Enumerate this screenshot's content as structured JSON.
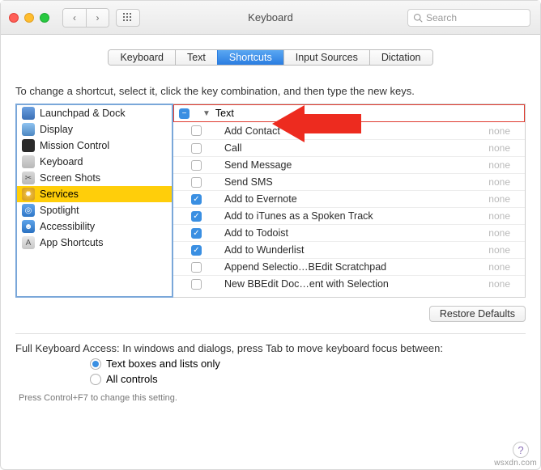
{
  "window": {
    "title": "Keyboard"
  },
  "toolbar": {
    "search_placeholder": "Search"
  },
  "tabs": {
    "keyboard": "Keyboard",
    "text": "Text",
    "shortcuts": "Shortcuts",
    "input_sources": "Input Sources",
    "dictation": "Dictation"
  },
  "instruction": "To change a shortcut, select it, click the key combination, and then type the new keys.",
  "categories": [
    {
      "label": "Launchpad & Dock"
    },
    {
      "label": "Display"
    },
    {
      "label": "Mission Control"
    },
    {
      "label": "Keyboard"
    },
    {
      "label": "Screen Shots"
    },
    {
      "label": "Services"
    },
    {
      "label": "Spotlight"
    },
    {
      "label": "Accessibility"
    },
    {
      "label": "App Shortcuts"
    }
  ],
  "group": {
    "label": "Text"
  },
  "services": [
    {
      "checked": false,
      "label": "Add Contact",
      "shortcut": "none"
    },
    {
      "checked": false,
      "label": "Call",
      "shortcut": "none"
    },
    {
      "checked": false,
      "label": "Send Message",
      "shortcut": "none"
    },
    {
      "checked": false,
      "label": "Send SMS",
      "shortcut": "none"
    },
    {
      "checked": true,
      "label": "Add to Evernote",
      "shortcut": "none"
    },
    {
      "checked": true,
      "label": "Add to iTunes as a Spoken Track",
      "shortcut": "none"
    },
    {
      "checked": true,
      "label": "Add to Todoist",
      "shortcut": "none"
    },
    {
      "checked": true,
      "label": "Add to Wunderlist",
      "shortcut": "none"
    },
    {
      "checked": false,
      "label": "Append Selectio…BEdit Scratchpad",
      "shortcut": "none"
    },
    {
      "checked": false,
      "label": "New BBEdit Doc…ent with Selection",
      "shortcut": "none"
    }
  ],
  "buttons": {
    "restore": "Restore Defaults"
  },
  "fka": {
    "label": "Full Keyboard Access: In windows and dialogs, press Tab to move keyboard focus between:",
    "opt1": "Text boxes and lists only",
    "opt2": "All controls",
    "hint": "Press Control+F7 to change this setting."
  },
  "watermark": "wsxdn.com"
}
